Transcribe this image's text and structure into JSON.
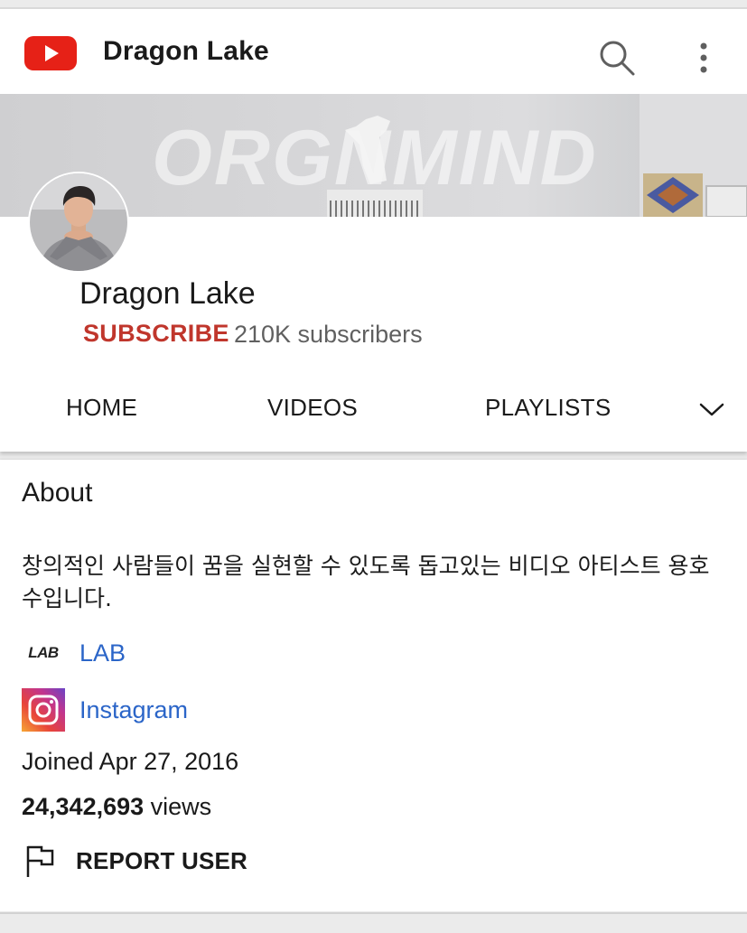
{
  "app_bar": {
    "title": "Dragon Lake",
    "logo_icon": "youtube-logo-icon",
    "search_icon": "search-icon",
    "more_icon": "more-vertical-icon",
    "brand_color": "#e62117"
  },
  "banner": {
    "text": "ORGNMIND"
  },
  "channel": {
    "name": "Dragon Lake",
    "subscribe_label": "SUBSCRIBE",
    "subscriber_count": "210K subscribers",
    "subscribe_color": "#c0362c"
  },
  "tabs": [
    {
      "label": "HOME"
    },
    {
      "label": "VIDEOS"
    },
    {
      "label": "PLAYLISTS"
    }
  ],
  "about": {
    "title": "About",
    "description": "창의적인 사람들이 꿈을 실현할 수 있도록 돕고있는 비디오 아티스트 용호수입니다.",
    "links": [
      {
        "label": "LAB",
        "icon": "lab-logo-icon",
        "icon_text": "LAB"
      },
      {
        "label": "Instagram",
        "icon": "instagram-icon"
      }
    ],
    "joined": "Joined Apr 27, 2016",
    "views_number": "24,342,693",
    "views_suffix": " views",
    "report_label": "REPORT USER",
    "link_color": "#2b65c8"
  }
}
